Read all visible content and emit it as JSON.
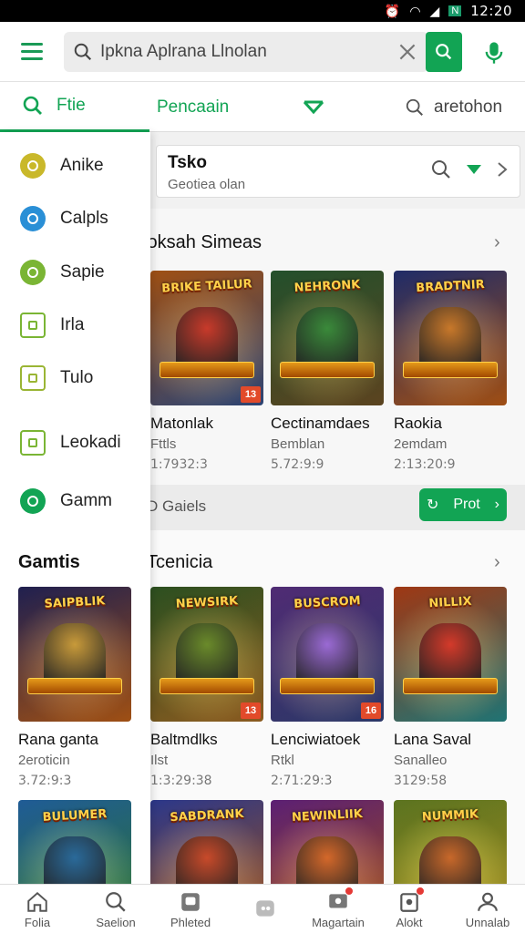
{
  "status_bar": {
    "time": "12:20"
  },
  "search": {
    "query": "Ipkna Aplrana Llnolan"
  },
  "tabs": {
    "file": "Ftie",
    "pencarian": "Pencaain",
    "search": "aretohon"
  },
  "drawer": {
    "items": [
      {
        "label": "Anike",
        "icon": "compass-icon",
        "color": "#c9b82a"
      },
      {
        "label": "Calpls",
        "icon": "check-circle-icon",
        "color": "#2a8fd6"
      },
      {
        "label": "Sapie",
        "icon": "leaf-icon",
        "color": "#7ab534"
      },
      {
        "label": "Irla",
        "icon": "app-square-icon",
        "color": "#7ab534"
      },
      {
        "label": "Tulo",
        "icon": "chart-square-icon",
        "color": "#9ab534"
      },
      {
        "label": "Leokadi",
        "icon": "layers-square-icon",
        "color": "#7ab534"
      },
      {
        "label": "Gamm",
        "icon": "gamepad-icon",
        "color": "#12a454"
      }
    ],
    "section_title": "Gamtis"
  },
  "toko": {
    "title": "Tsko",
    "subtitle": "Geotiea olan"
  },
  "section1": {
    "title": "loksah Simeas",
    "games": [
      {
        "cover_title": "BRIKE TAILUR",
        "cover_colors": [
          "#d46a1a",
          "#3a5a9a"
        ],
        "hero": "#c83a2a",
        "badge": "13",
        "name": "Matonlak",
        "sub": "Fttls",
        "meta": "1:7932:3"
      },
      {
        "cover_title": "NEHRONK",
        "cover_colors": [
          "#2f6a3a",
          "#7a5a2a"
        ],
        "hero": "#3a8a3a",
        "badge": "",
        "name": "Cectinamdaes",
        "sub": "Bemblan",
        "meta": "5.72:9:9"
      },
      {
        "cover_title": "BRADTNIR",
        "cover_colors": [
          "#2a3a8a",
          "#d4681a"
        ],
        "hero": "#c8782a",
        "badge": "",
        "name": "Raokia",
        "sub": "2emdam",
        "meta": "2:13:20:9"
      }
    ]
  },
  "galeri": {
    "label": "D Gaiels",
    "button": "Prot"
  },
  "section2": {
    "title": "Tcenicia",
    "games": [
      {
        "cover_title": "SAIPBLIK",
        "cover_colors": [
          "#2a2a6a",
          "#d46a1a"
        ],
        "hero": "#c89a3a",
        "badge": "",
        "name": "Rana ganta",
        "sub": "2eroticin",
        "meta": "3.72:9:3"
      },
      {
        "cover_title": "NEWSIRK",
        "cover_colors": [
          "#3a6a2a",
          "#b8782a"
        ],
        "hero": "#6a8a2a",
        "badge": "13",
        "name": "Baltmdlks",
        "sub": "Ilst",
        "meta": "1:3:29:38"
      },
      {
        "cover_title": "BUSCROM",
        "cover_colors": [
          "#6a3a9a",
          "#3a4a8a"
        ],
        "hero": "#9a6ad4",
        "badge": "16",
        "name": "Lenciwiatoek",
        "sub": "Rtkl",
        "meta": "2:71:29:3"
      },
      {
        "cover_title": "NILLIX",
        "cover_colors": [
          "#d44a1a",
          "#2a9a9a"
        ],
        "hero": "#d43a2a",
        "badge": "",
        "name": "Lana Saval",
        "sub": "Sanalleo",
        "meta": "3129:58"
      }
    ]
  },
  "section3": {
    "games": [
      {
        "cover_title": "BULUMER",
        "cover_colors": [
          "#2a7ac8",
          "#3a9a3a"
        ],
        "hero": "#2a6a9a"
      },
      {
        "cover_title": "SABDRANK",
        "cover_colors": [
          "#3a4ab8",
          "#d46a1a"
        ],
        "hero": "#c84a2a"
      },
      {
        "cover_title": "NEWINLIIK",
        "cover_colors": [
          "#7a2a9a",
          "#d46a1a"
        ],
        "hero": "#d4682a"
      },
      {
        "cover_title": "NUMMIK",
        "cover_colors": [
          "#7a9a2a",
          "#d4b82a"
        ],
        "hero": "#c8682a"
      }
    ]
  },
  "bottom_nav": [
    {
      "label": "Folia",
      "icon": "home-icon"
    },
    {
      "label": "Saelion",
      "icon": "search-icon"
    },
    {
      "label": "Phleted",
      "icon": "photo-icon"
    },
    {
      "label": "",
      "icon": "video-icon"
    },
    {
      "label": "Magartain",
      "icon": "message-icon"
    },
    {
      "label": "Alokt",
      "icon": "bell-icon"
    },
    {
      "label": "Unnalab",
      "icon": "user-icon"
    }
  ],
  "colors": {
    "accent": "#12a454",
    "notification": "#e53935"
  }
}
